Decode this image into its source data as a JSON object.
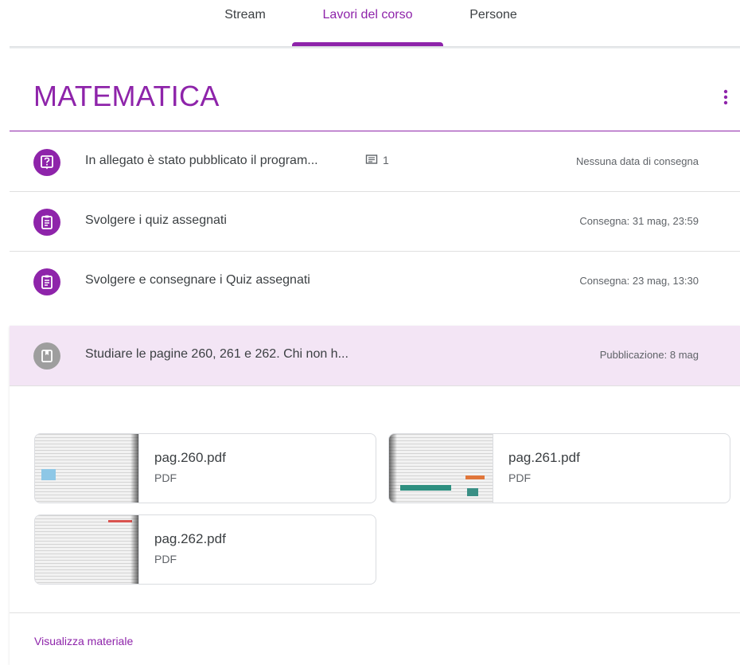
{
  "tabs": [
    {
      "label": "Stream"
    },
    {
      "label": "Lavori del corso"
    },
    {
      "label": "Persone"
    }
  ],
  "topic": {
    "title": "MATEMATICA"
  },
  "items": [
    {
      "icon": "question-assignment-icon",
      "title": "In allegato è stato pubblicato il program...",
      "comments": "1",
      "date": "Nessuna data di consegna"
    },
    {
      "icon": "assignment-icon",
      "title": "Svolgere i quiz assegnati",
      "date": "Consegna: 31 mag, 23:59"
    },
    {
      "icon": "assignment-icon",
      "title": "Svolgere e consegnare i Quiz assegnati",
      "date": "Consegna: 23 mag, 13:30"
    }
  ],
  "material": {
    "icon": "material-icon",
    "title": "Studiare le pagine 260, 261 e 262. Chi non h...",
    "date": "Pubblicazione: 8 mag",
    "attachments": [
      {
        "name": "pag.260.pdf",
        "type": "PDF"
      },
      {
        "name": "pag.261.pdf",
        "type": "PDF"
      },
      {
        "name": "pag.262.pdf",
        "type": "PDF"
      }
    ],
    "view_label": "Visualizza materiale"
  },
  "colors": {
    "accent": "#8e24aa",
    "accent_light": "#f3e5f5",
    "material_icon": "#9e9e9e"
  }
}
